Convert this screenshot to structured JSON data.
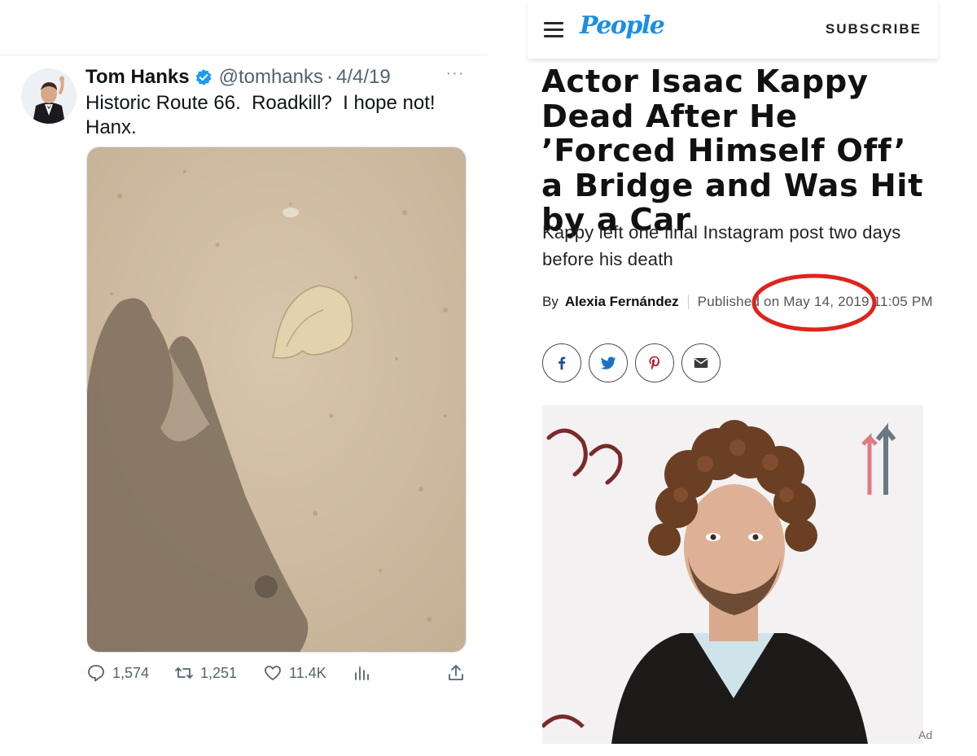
{
  "tweet": {
    "author_name": "Tom Hanks",
    "handle": "@tomhanks",
    "separator": "·",
    "date": "4/4/19",
    "more_label": "···",
    "text": "Historic Route 66.  Roadkill?  I hope not!\nHanx.",
    "stats": {
      "replies": "1,574",
      "retweets": "1,251",
      "likes": "11.4K"
    },
    "icons": [
      "verified-badge-icon",
      "more-icon",
      "reply-icon",
      "retweet-icon",
      "like-icon",
      "views-icon",
      "share-icon"
    ],
    "colors": {
      "verified": "#1d9bf0",
      "text": "#0f1419",
      "muted": "#536471"
    }
  },
  "article": {
    "header": {
      "logo": "People",
      "subscribe": "SUBSCRIBE",
      "menu_icon": "hamburger-menu-icon"
    },
    "headline": "Actor Isaac Kappy Dead After He ’Forced Himself Off’ a Bridge and Was Hit by a Car",
    "dek": "Kappy left one final Instagram post two days before his death",
    "byline": {
      "by": "By",
      "author": "Alexia Fernández",
      "published": "Published on May 14, 2019 11:05 PM"
    },
    "share_buttons": [
      {
        "icon": "facebook-icon"
      },
      {
        "icon": "twitter-icon"
      },
      {
        "icon": "pinterest-icon"
      },
      {
        "icon": "email-icon"
      }
    ],
    "ad_label": "Ad",
    "colors": {
      "logo": "#1d8fe1",
      "annotation_circle": "#e0231c"
    }
  }
}
